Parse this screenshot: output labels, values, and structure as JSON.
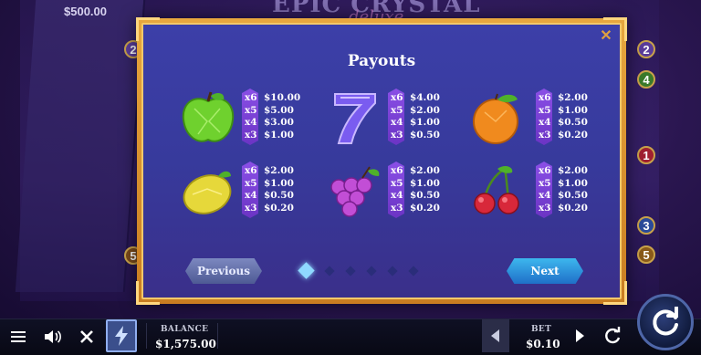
{
  "background": {
    "win_amount": "$500.00",
    "title_main": "EPIC CRYSTAL",
    "title_sub": "deluxe",
    "left_lines": [
      "2",
      "5"
    ],
    "right_lines": [
      "2",
      "4",
      "1",
      "3",
      "5"
    ]
  },
  "modal": {
    "title": "Payouts",
    "close_icon": "close-icon",
    "symbols": [
      {
        "name": "green-apple",
        "color": "#7ad93a",
        "payouts": [
          [
            "x6",
            "$10.00"
          ],
          [
            "x5",
            "$5.00"
          ],
          [
            "x4",
            "$3.00"
          ],
          [
            "x3",
            "$1.00"
          ]
        ]
      },
      {
        "name": "seven",
        "color": "#8c6cff",
        "payouts": [
          [
            "x6",
            "$4.00"
          ],
          [
            "x5",
            "$2.00"
          ],
          [
            "x4",
            "$1.00"
          ],
          [
            "x3",
            "$0.50"
          ]
        ]
      },
      {
        "name": "orange",
        "color": "#f08a1e",
        "payouts": [
          [
            "x6",
            "$2.00"
          ],
          [
            "x5",
            "$1.00"
          ],
          [
            "x4",
            "$0.50"
          ],
          [
            "x3",
            "$0.20"
          ]
        ]
      },
      {
        "name": "lemon",
        "color": "#e6d83a",
        "payouts": [
          [
            "x6",
            "$2.00"
          ],
          [
            "x5",
            "$1.00"
          ],
          [
            "x4",
            "$0.50"
          ],
          [
            "x3",
            "$0.20"
          ]
        ]
      },
      {
        "name": "grapes",
        "color": "#c24ed6",
        "payouts": [
          [
            "x6",
            "$2.00"
          ],
          [
            "x5",
            "$1.00"
          ],
          [
            "x4",
            "$0.50"
          ],
          [
            "x3",
            "$0.20"
          ]
        ]
      },
      {
        "name": "cherries",
        "color": "#d8283a",
        "payouts": [
          [
            "x6",
            "$2.00"
          ],
          [
            "x5",
            "$1.00"
          ],
          [
            "x4",
            "$0.50"
          ],
          [
            "x3",
            "$0.20"
          ]
        ]
      }
    ],
    "previous_label": "Previous",
    "next_label": "Next",
    "pages": 6,
    "current_page": 1
  },
  "bottom_bar": {
    "balance_label": "BALANCE",
    "balance_value": "$1,575.00",
    "bet_label": "BET",
    "bet_value": "$0.10",
    "icons": [
      "menu-icon",
      "sound-icon",
      "close-icon",
      "turbo-icon",
      "bet-decrease-icon",
      "bet-increase-icon",
      "autoplay-icon",
      "spin-icon"
    ]
  },
  "colors": {
    "frame_gold": "#e7a73e",
    "panel_blue": "#3c3fa8",
    "payout_purple": "#7a42d6",
    "next_button": "#2a8fe0"
  }
}
